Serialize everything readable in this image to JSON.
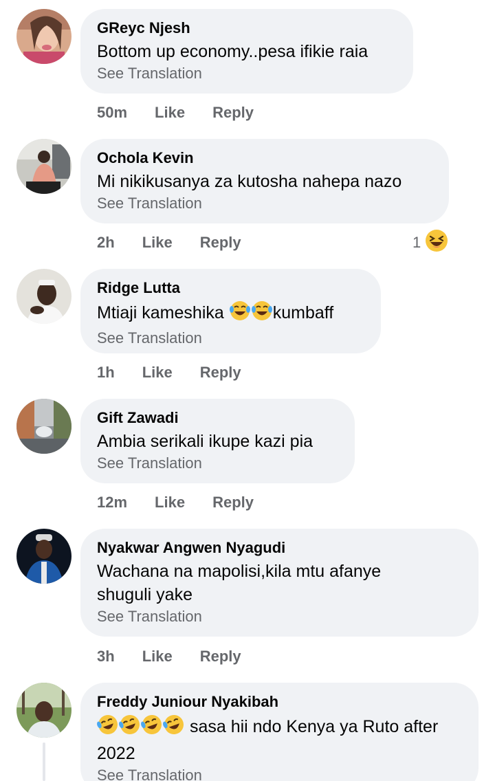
{
  "see_translation": "See Translation",
  "like_label": "Like",
  "reply_label": "Reply",
  "comments": [
    {
      "author": "GReyc Njesh",
      "text": "Bottom up economy..pesa ifikie raia",
      "time": "50m"
    },
    {
      "author": "Ochola Kevin",
      "text": "Mi nikikusanya za kutosha nahepa nazo",
      "time": "2h",
      "reaction_count": "1",
      "reaction_icon": "laughing-squint-emoji"
    },
    {
      "author": "Ridge Lutta",
      "text_before": "Mtiaji kameshika ",
      "text_after": "kumbaff",
      "time": "1h"
    },
    {
      "author": "Gift Zawadi",
      "text": "Ambia serikali ikupe kazi pia",
      "time": "12m"
    },
    {
      "author": "Nyakwar Angwen Nyagudi",
      "text_line1": "Wachana na mapolisi,kila mtu afanye",
      "text_line2": "shuguli yake",
      "time": "3h"
    },
    {
      "author": "Freddy Juniour Nyakibah",
      "text_line1": " sasa hii ndo Kenya ya Ruto after",
      "text_line2": "2022"
    }
  ],
  "colors": {
    "bubble_bg": "#f0f2f5",
    "secondary_text": "#65676b",
    "primary_text": "#050505"
  }
}
